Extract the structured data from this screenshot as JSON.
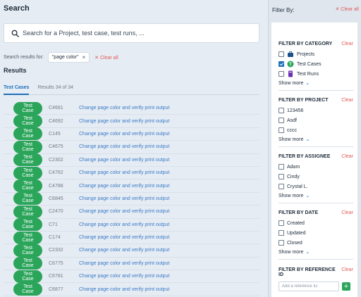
{
  "header": {
    "title": "Search"
  },
  "search": {
    "placeholder": "Search for a Project, test case, test runs, ..."
  },
  "search_results_for": {
    "label": "Search results for:",
    "chip": "\"page color\"",
    "chip_close": "×",
    "clear_all": "✕ Clear all"
  },
  "results": {
    "heading": "Results",
    "tab_label": "Test Cases",
    "count": "Results 34 of 34"
  },
  "rows": [
    {
      "badge": "Test Case",
      "id": "C4661",
      "title": "Change page color and verify print output"
    },
    {
      "badge": "Test Case",
      "id": "C4692",
      "title": "Change page color and verify print output"
    },
    {
      "badge": "Test Case",
      "id": "C145",
      "title": "Change page color and verify print output"
    },
    {
      "badge": "Test Case",
      "id": "C4675",
      "title": "Change page color and verify print output"
    },
    {
      "badge": "Test Case",
      "id": "C2302",
      "title": "Change page color and verify print output"
    },
    {
      "badge": "Test Case",
      "id": "C4762",
      "title": "Change page color and verify print output"
    },
    {
      "badge": "Test Case",
      "id": "C4788",
      "title": "Change page color and verify print output"
    },
    {
      "badge": "Test Case",
      "id": "C6845",
      "title": "Change page color and verify print output"
    },
    {
      "badge": "Test Case",
      "id": "C2470",
      "title": "Change page color and verify print output"
    },
    {
      "badge": "Test Case",
      "id": "C71",
      "title": "Change page color and verify print output"
    },
    {
      "badge": "Test Case",
      "id": "C174",
      "title": "Change page color and verify print output"
    },
    {
      "badge": "Test Case",
      "id": "C2332",
      "title": "Change page color and verify print output"
    },
    {
      "badge": "Test Case",
      "id": "C6775",
      "title": "Change page color and verify print output"
    },
    {
      "badge": "Test Case",
      "id": "C6781",
      "title": "Change page color and verify print output"
    },
    {
      "badge": "Test Case",
      "id": "C6877",
      "title": "Change page color and verify print output"
    }
  ],
  "filters": {
    "title": "Filter By:",
    "clear_all": "✕ Clear all",
    "category": {
      "heading": "FILTER BY CATEGORY",
      "clear": "Clear",
      "options": [
        {
          "label": "Projects",
          "checked": false,
          "icon": "briefcase-icon"
        },
        {
          "label": "Test Cases",
          "checked": true,
          "icon": "test-case-icon"
        },
        {
          "label": "Test Runs",
          "checked": false,
          "icon": "test-run-icon"
        }
      ],
      "show_more": "Show more"
    },
    "project": {
      "heading": "FILTER BY PROJECT",
      "clear": "Clear",
      "options": [
        {
          "label": "123456",
          "checked": false
        },
        {
          "label": "Asdf",
          "checked": false
        },
        {
          "label": "cccc",
          "checked": false
        }
      ],
      "show_more": "Show more"
    },
    "assignee": {
      "heading": "FILTER BY ASSIGNEE",
      "clear": "Clear",
      "options": [
        {
          "label": "Adam",
          "checked": false
        },
        {
          "label": "Cindy",
          "checked": false
        },
        {
          "label": "Crystal L.",
          "checked": false
        }
      ],
      "show_more": "Show more"
    },
    "date": {
      "heading": "FILTER BY DATE",
      "clear": "Clear",
      "options": [
        {
          "label": "Created",
          "checked": false
        },
        {
          "label": "Updated",
          "checked": false
        },
        {
          "label": "Closed",
          "checked": false
        }
      ],
      "show_more": "Show more"
    },
    "reference": {
      "heading_line1": "FILTER BY REFERENCE",
      "heading_line2": "ID",
      "clear": "Clear",
      "placeholder": "Add a reference ID",
      "add": "+"
    }
  },
  "colors": {
    "accent": "#1d6fb8",
    "badge_green": "#2aa55a",
    "clear_red": "#e05a5a"
  }
}
